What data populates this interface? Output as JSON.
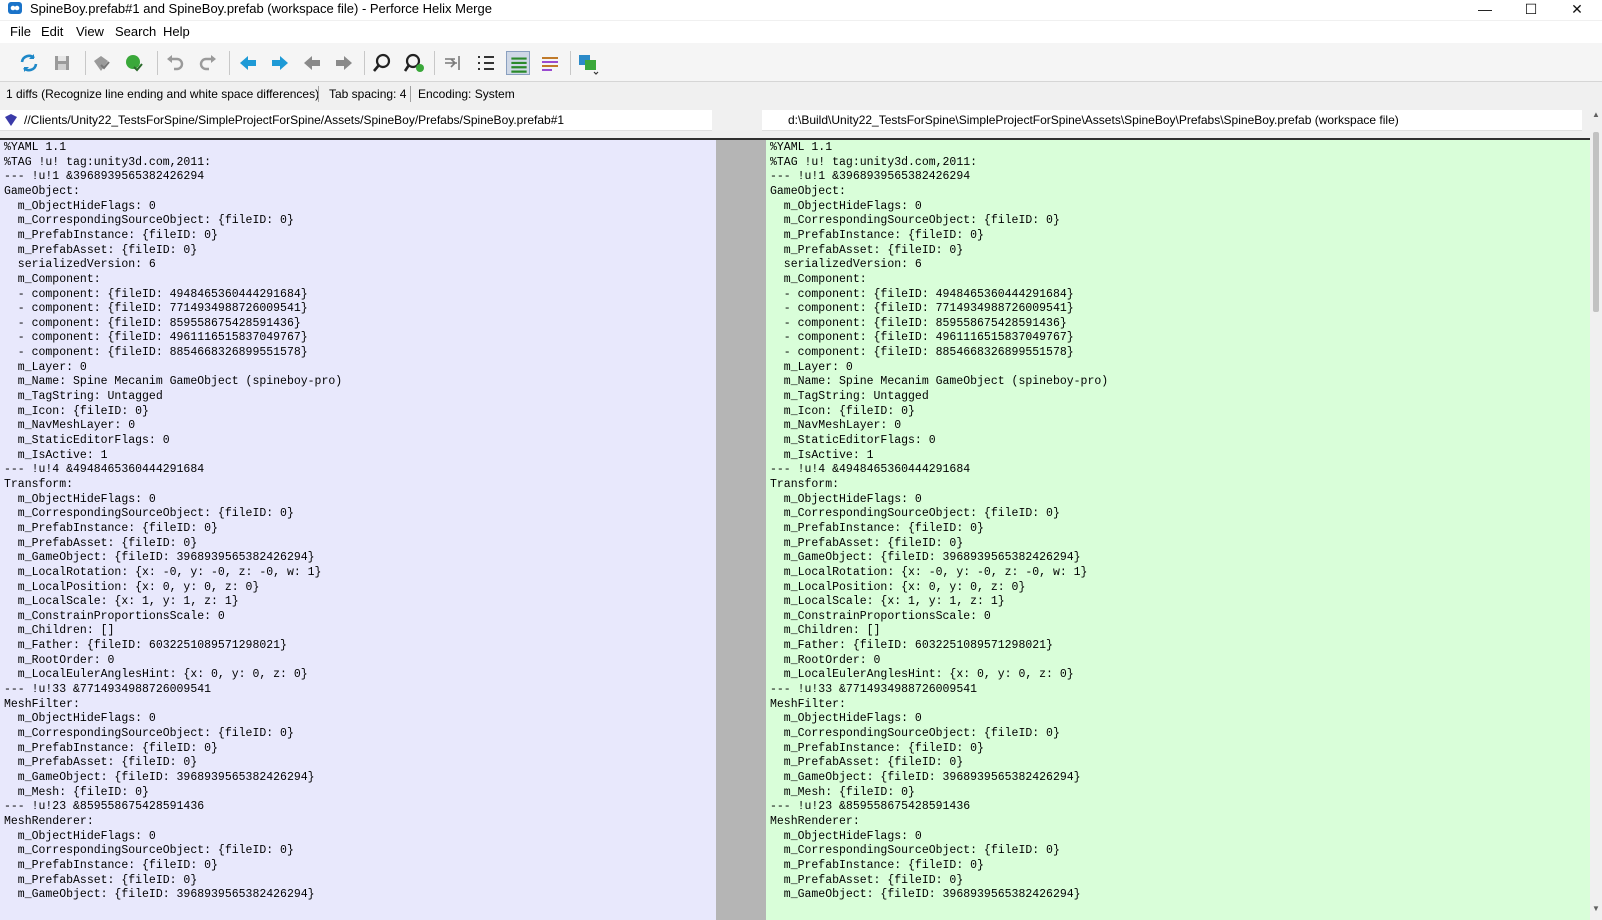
{
  "window": {
    "title": "SpineBoy.prefab#1 and SpineBoy.prefab (workspace file) - Perforce Helix Merge",
    "controls": {
      "minimize": "—",
      "maximize": "☐",
      "close": "✕"
    }
  },
  "menu": [
    "File",
    "Edit",
    "View",
    "Search",
    "Help"
  ],
  "toolbar": {
    "buttons": [
      "refresh",
      "save",
      "accept-base",
      "accept-theirs",
      "undo",
      "redo",
      "prev-diff",
      "next-diff",
      "prev-change",
      "next-change",
      "find",
      "find-next",
      "go-to-line",
      "line-numbers",
      "show-whitespace",
      "show-inline-diffs",
      "layout"
    ]
  },
  "status": {
    "diffs": "1 diffs (Recognize line ending and white space differences)",
    "tab_spacing": "Tab spacing: 4",
    "encoding": "Encoding: System"
  },
  "paths": {
    "left": "//Clients/Unity22_TestsForSpine/SimpleProjectForSpine/Assets/SpineBoy/Prefabs/SpineBoy.prefab#1",
    "right": "d:\\Build\\Unity22_TestsForSpine\\SimpleProjectForSpine\\Assets\\SpineBoy\\Prefabs\\SpineBoy.prefab (workspace file)"
  },
  "colors": {
    "left_pane_bg": "#e8e8fc",
    "right_pane_bg": "#d9fed9",
    "gutter": "#b5b5b5",
    "base_marker": "#3a3aa8",
    "theirs_marker": "#2fae2f"
  },
  "left_lines": [
    "%YAML 1.1",
    "%TAG !u! tag:unity3d.com,2011:",
    "--- !u!1 &3968939565382426294",
    "GameObject:",
    "  m_ObjectHideFlags: 0",
    "  m_CorrespondingSourceObject: {fileID: 0}",
    "  m_PrefabInstance: {fileID: 0}",
    "  m_PrefabAsset: {fileID: 0}",
    "  serializedVersion: 6",
    "  m_Component:",
    "  - component: {fileID: 4948465360444291684}",
    "  - component: {fileID: 7714934988726009541}",
    "  - component: {fileID: 859558675428591436}",
    "  - component: {fileID: 4961116515837049767}",
    "  - component: {fileID: 8854668326899551578}",
    "  m_Layer: 0",
    "  m_Name: Spine Mecanim GameObject (spineboy-pro)",
    "  m_TagString: Untagged",
    "  m_Icon: {fileID: 0}",
    "  m_NavMeshLayer: 0",
    "  m_StaticEditorFlags: 0",
    "  m_IsActive: 1",
    "--- !u!4 &4948465360444291684",
    "Transform:",
    "  m_ObjectHideFlags: 0",
    "  m_CorrespondingSourceObject: {fileID: 0}",
    "  m_PrefabInstance: {fileID: 0}",
    "  m_PrefabAsset: {fileID: 0}",
    "  m_GameObject: {fileID: 3968939565382426294}",
    "  m_LocalRotation: {x: -0, y: -0, z: -0, w: 1}",
    "  m_LocalPosition: {x: 0, y: 0, z: 0}",
    "  m_LocalScale: {x: 1, y: 1, z: 1}",
    "  m_ConstrainProportionsScale: 0",
    "  m_Children: []",
    "  m_Father: {fileID: 6032251089571298021}",
    "  m_RootOrder: 0",
    "  m_LocalEulerAnglesHint: {x: 0, y: 0, z: 0}",
    "--- !u!33 &7714934988726009541",
    "MeshFilter:",
    "  m_ObjectHideFlags: 0",
    "  m_CorrespondingSourceObject: {fileID: 0}",
    "  m_PrefabInstance: {fileID: 0}",
    "  m_PrefabAsset: {fileID: 0}",
    "  m_GameObject: {fileID: 3968939565382426294}",
    "  m_Mesh: {fileID: 0}",
    "--- !u!23 &859558675428591436",
    "MeshRenderer:",
    "  m_ObjectHideFlags: 0",
    "  m_CorrespondingSourceObject: {fileID: 0}",
    "  m_PrefabInstance: {fileID: 0}",
    "  m_PrefabAsset: {fileID: 0}",
    "  m_GameObject: {fileID: 3968939565382426294}"
  ],
  "right_lines": [
    "%YAML 1.1",
    "%TAG !u! tag:unity3d.com,2011:",
    "--- !u!1 &3968939565382426294",
    "GameObject:",
    "  m_ObjectHideFlags: 0",
    "  m_CorrespondingSourceObject: {fileID: 0}",
    "  m_PrefabInstance: {fileID: 0}",
    "  m_PrefabAsset: {fileID: 0}",
    "  serializedVersion: 6",
    "  m_Component:",
    "  - component: {fileID: 4948465360444291684}",
    "  - component: {fileID: 7714934988726009541}",
    "  - component: {fileID: 859558675428591436}",
    "  - component: {fileID: 4961116515837049767}",
    "  - component: {fileID: 8854668326899551578}",
    "  m_Layer: 0",
    "  m_Name: Spine Mecanim GameObject (spineboy-pro)",
    "  m_TagString: Untagged",
    "  m_Icon: {fileID: 0}",
    "  m_NavMeshLayer: 0",
    "  m_StaticEditorFlags: 0",
    "  m_IsActive: 1",
    "--- !u!4 &4948465360444291684",
    "Transform:",
    "  m_ObjectHideFlags: 0",
    "  m_CorrespondingSourceObject: {fileID: 0}",
    "  m_PrefabInstance: {fileID: 0}",
    "  m_PrefabAsset: {fileID: 0}",
    "  m_GameObject: {fileID: 3968939565382426294}",
    "  m_LocalRotation: {x: -0, y: -0, z: -0, w: 1}",
    "  m_LocalPosition: {x: 0, y: 0, z: 0}",
    "  m_LocalScale: {x: 1, y: 1, z: 1}",
    "  m_ConstrainProportionsScale: 0",
    "  m_Children: []",
    "  m_Father: {fileID: 6032251089571298021}",
    "  m_RootOrder: 0",
    "  m_LocalEulerAnglesHint: {x: 0, y: 0, z: 0}",
    "--- !u!33 &7714934988726009541",
    "MeshFilter:",
    "  m_ObjectHideFlags: 0",
    "  m_CorrespondingSourceObject: {fileID: 0}",
    "  m_PrefabInstance: {fileID: 0}",
    "  m_PrefabAsset: {fileID: 0}",
    "  m_GameObject: {fileID: 3968939565382426294}",
    "  m_Mesh: {fileID: 0}",
    "--- !u!23 &859558675428591436",
    "MeshRenderer:",
    "  m_ObjectHideFlags: 0",
    "  m_CorrespondingSourceObject: {fileID: 0}",
    "  m_PrefabInstance: {fileID: 0}",
    "  m_PrefabAsset: {fileID: 0}",
    "  m_GameObject: {fileID: 3968939565382426294}"
  ]
}
